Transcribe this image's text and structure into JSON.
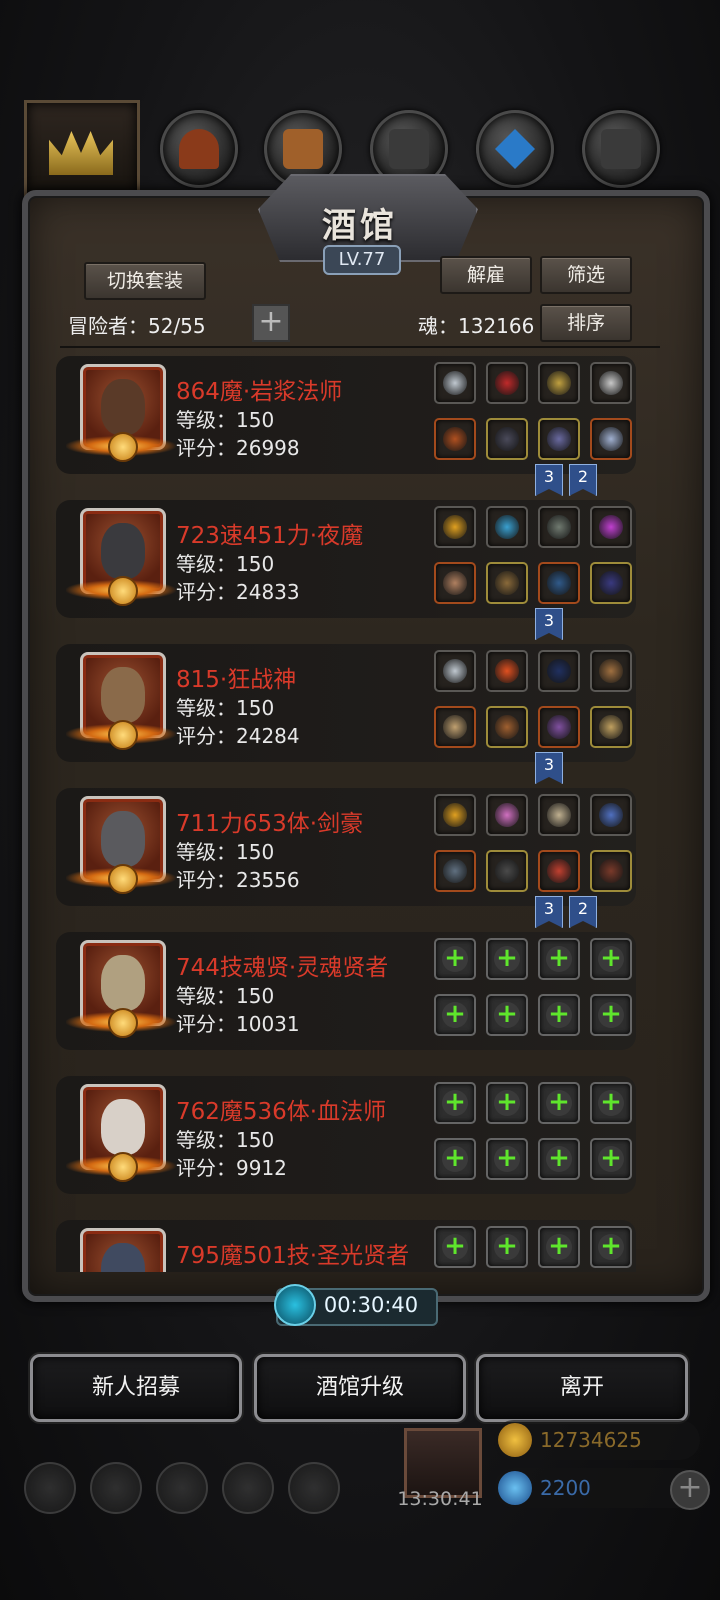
{
  "header": {
    "title": "酒馆",
    "level": "LV.77",
    "switch_outfit_label": "切换套装",
    "dismiss_label": "解雇",
    "filter_label": "筛选",
    "sort_label": "排序",
    "adventurers_label": "冒险者：52/55",
    "soul_label": "魂：132166"
  },
  "top_categories": [
    "crown-icon",
    "helmet-icon",
    "armor-icon",
    "gauntlet-icon",
    "crystal-icon",
    "boots-icon"
  ],
  "heroes": [
    {
      "name": "864魔·岩浆法师",
      "level": "等级：150",
      "score": "评分：26998",
      "face": "#5a3a28",
      "ribbons": [
        "3",
        "2"
      ],
      "items": [
        [
          "gray",
          "#c0c8d0"
        ],
        [
          "gray",
          "#c02a2a"
        ],
        [
          "gray",
          "#c0a040"
        ],
        [
          "gray",
          "#c8c8c8"
        ],
        [
          "red",
          "#b05020"
        ],
        [
          "gold",
          "#4a4a5a"
        ],
        [
          "gold",
          "#6a6aa0"
        ],
        [
          "red",
          "#a0b0d0"
        ]
      ]
    },
    {
      "name": "723速451力·夜魔",
      "level": "等级：150",
      "score": "评分：24833",
      "face": "#3a3a3e",
      "ribbons": [
        "3"
      ],
      "items": [
        [
          "gray",
          "#e0a020"
        ],
        [
          "gray",
          "#3aa0d0"
        ],
        [
          "gray",
          "#707a70"
        ],
        [
          "gray",
          "#c040d0"
        ],
        [
          "red",
          "#b08060"
        ],
        [
          "gold",
          "#8a6a3a"
        ],
        [
          "red",
          "#305a8a"
        ],
        [
          "gold",
          "#3a3a80"
        ]
      ]
    },
    {
      "name": "815·狂战神",
      "level": "等级：150",
      "score": "评分：24284",
      "face": "#8a6a4a",
      "ribbons": [
        "3"
      ],
      "items": [
        [
          "gray",
          "#c0c8d0"
        ],
        [
          "gray",
          "#e05020"
        ],
        [
          "gray",
          "#203060"
        ],
        [
          "gray",
          "#a07040"
        ],
        [
          "red",
          "#c0a070"
        ],
        [
          "gold",
          "#a06030"
        ],
        [
          "red",
          "#8050a0"
        ],
        [
          "gold",
          "#c0a060"
        ]
      ]
    },
    {
      "name": "711力653体·剑豪",
      "level": "等级：150",
      "score": "评分：23556",
      "face": "#5a5a5e",
      "ribbons": [
        "3",
        "2"
      ],
      "items": [
        [
          "gray",
          "#e0a020"
        ],
        [
          "gray",
          "#d070c0"
        ],
        [
          "gray",
          "#c0b090"
        ],
        [
          "gray",
          "#5070c0"
        ],
        [
          "red",
          "#607080"
        ],
        [
          "gold",
          "#4a4a4a"
        ],
        [
          "red",
          "#c04030"
        ],
        [
          "gold",
          "#7a3a2a"
        ]
      ]
    },
    {
      "name": "744技魂贤·灵魂贤者",
      "level": "等级：150",
      "score": "评分：10031",
      "face": "#b0a080",
      "ribbons": [],
      "items": "empty"
    },
    {
      "name": "762魔536体·血法师",
      "level": "等级：150",
      "score": "评分：9912",
      "face": "#d8d0c8",
      "ribbons": [],
      "items": "empty"
    },
    {
      "name": "795魔501技·圣光贤者",
      "level": "",
      "score": "",
      "face": "#404a60",
      "ribbons": [],
      "items": "empty"
    }
  ],
  "timer": "00:30:40",
  "buttons": {
    "recruit_label": "新人招募",
    "upgrade_label": "酒馆升级",
    "leave_label": "离开"
  },
  "bottom_bar": {
    "gift_time": "13:30:41",
    "gold_value": "12734625",
    "gem_value": "2200"
  },
  "colors": {
    "hero_name": "#d93a2a",
    "accent_green": "#5fe62c",
    "panel_bg": "#2d271f"
  }
}
